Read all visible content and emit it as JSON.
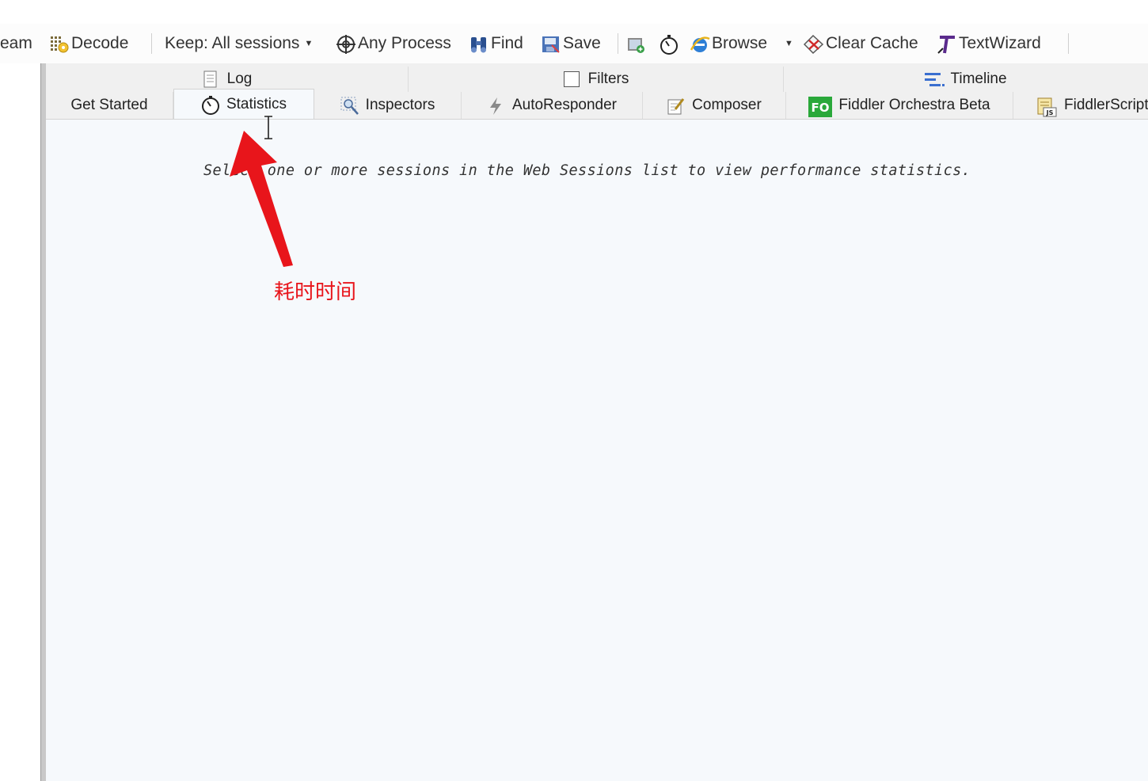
{
  "toolbar": {
    "stream_label": "eam",
    "decode_label": "Decode",
    "keep_label": "Keep: All sessions",
    "any_process_label": "Any Process",
    "find_label": "Find",
    "save_label": "Save",
    "browse_label": "Browse",
    "clear_cache_label": "Clear Cache",
    "textwizard_label": "TextWizard"
  },
  "tabs": {
    "row1": [
      {
        "label": "Log",
        "icon": "log-icon"
      },
      {
        "label": "Filters",
        "icon": "checkbox-icon"
      },
      {
        "label": "Timeline",
        "icon": "timeline-icon"
      }
    ],
    "row2": [
      {
        "label": "Get Started"
      },
      {
        "label": "Statistics",
        "icon": "stopwatch-icon",
        "active": true
      },
      {
        "label": "Inspectors",
        "icon": "inspector-icon"
      },
      {
        "label": "AutoResponder",
        "icon": "lightning-icon"
      },
      {
        "label": "Composer",
        "icon": "composer-icon"
      },
      {
        "label": "Fiddler Orchestra Beta",
        "icon": "fo-icon",
        "badge": "FO"
      },
      {
        "label": "FiddlerScript",
        "icon": "script-icon",
        "badge": "JS"
      }
    ]
  },
  "content": {
    "hint_text": "Select one or more sessions in the Web Sessions list to view performance statistics."
  },
  "annotation": {
    "label": "耗时时间",
    "color": "#e8151b"
  },
  "colors": {
    "content_bg": "#f6f9fc",
    "tab_bg": "#f0f0f0",
    "fo_badge": "#2aa83a"
  }
}
